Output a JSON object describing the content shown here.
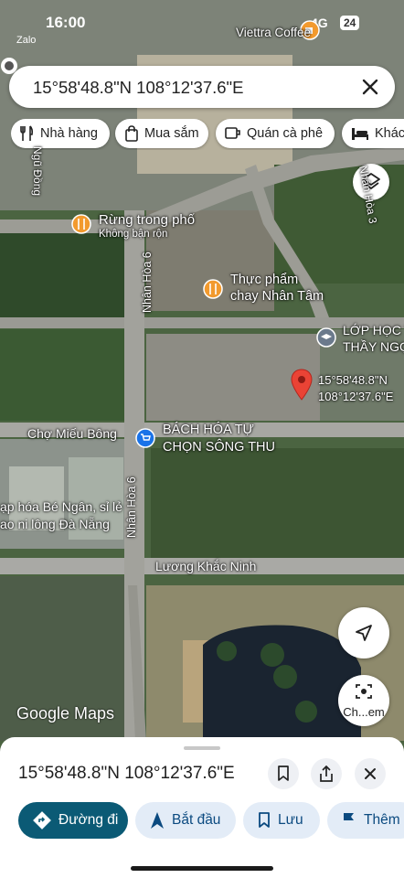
{
  "status_bar": {
    "time": "16:00",
    "network": "4G",
    "battery": "24"
  },
  "notification_app": "Zalo",
  "search": {
    "query": "15°58'48.8\"N 108°12'37.6\"E"
  },
  "chips": [
    {
      "label": "Nhà hàng",
      "icon": "restaurant-icon"
    },
    {
      "label": "Mua sắm",
      "icon": "shopping-bag-icon"
    },
    {
      "label": "Quán cà phê",
      "icon": "coffee-icon"
    },
    {
      "label": "Khách",
      "icon": "bed-icon"
    }
  ],
  "map_labels": {
    "viettra": "Viettra Coffee",
    "street_ng": "Nhân Hòa 3",
    "street_left": "Ngũ Đồng",
    "rung_title": "Rừng trong phố",
    "rung_sub": "Không bận rộn",
    "thucpham_1": "Thực phẩm",
    "thucpham_2": "chay Nhân Tâm",
    "lop_1": "LỚP HỌC T",
    "lop_2": "THẦY NGỌ",
    "pin_1": "15°58'48.8\"N",
    "pin_2": "108°12'37.6\"E",
    "cho": "Chợ Miếu Bông",
    "bachhoa_1": "BÁCH HÓA TỰ",
    "bachhoa_2": "CHỌN SÔNG THU",
    "taphoa_1": "ạp hóa Bé Ngân, sỉ lẻ",
    "taphoa_2": "ao ni lông Đà Nẵng",
    "nhanhoa6_a": "Nhân Hòa 6",
    "nhanhoa6_b": "Nhân Hòa 6",
    "luong": "Lương Khắc Ninh",
    "google_maps": "Google Maps"
  },
  "lens_label": "Ch...em",
  "sheet": {
    "coordinates": "15°58'48.8\"N 108°12'37.6\"E",
    "actions": [
      {
        "label": "Đường đi",
        "icon": "directions-icon"
      },
      {
        "label": "Bắt đầu",
        "icon": "navigate-arrow-icon"
      },
      {
        "label": "Lưu",
        "icon": "bookmark-icon"
      },
      {
        "label": "Thêm",
        "icon": "flag-icon"
      }
    ]
  },
  "colors": {
    "pin": "#ea4335",
    "poi_orange": "#f29a2e",
    "poi_blue": "#1a73e8",
    "directions_button": "#0b5a75"
  }
}
